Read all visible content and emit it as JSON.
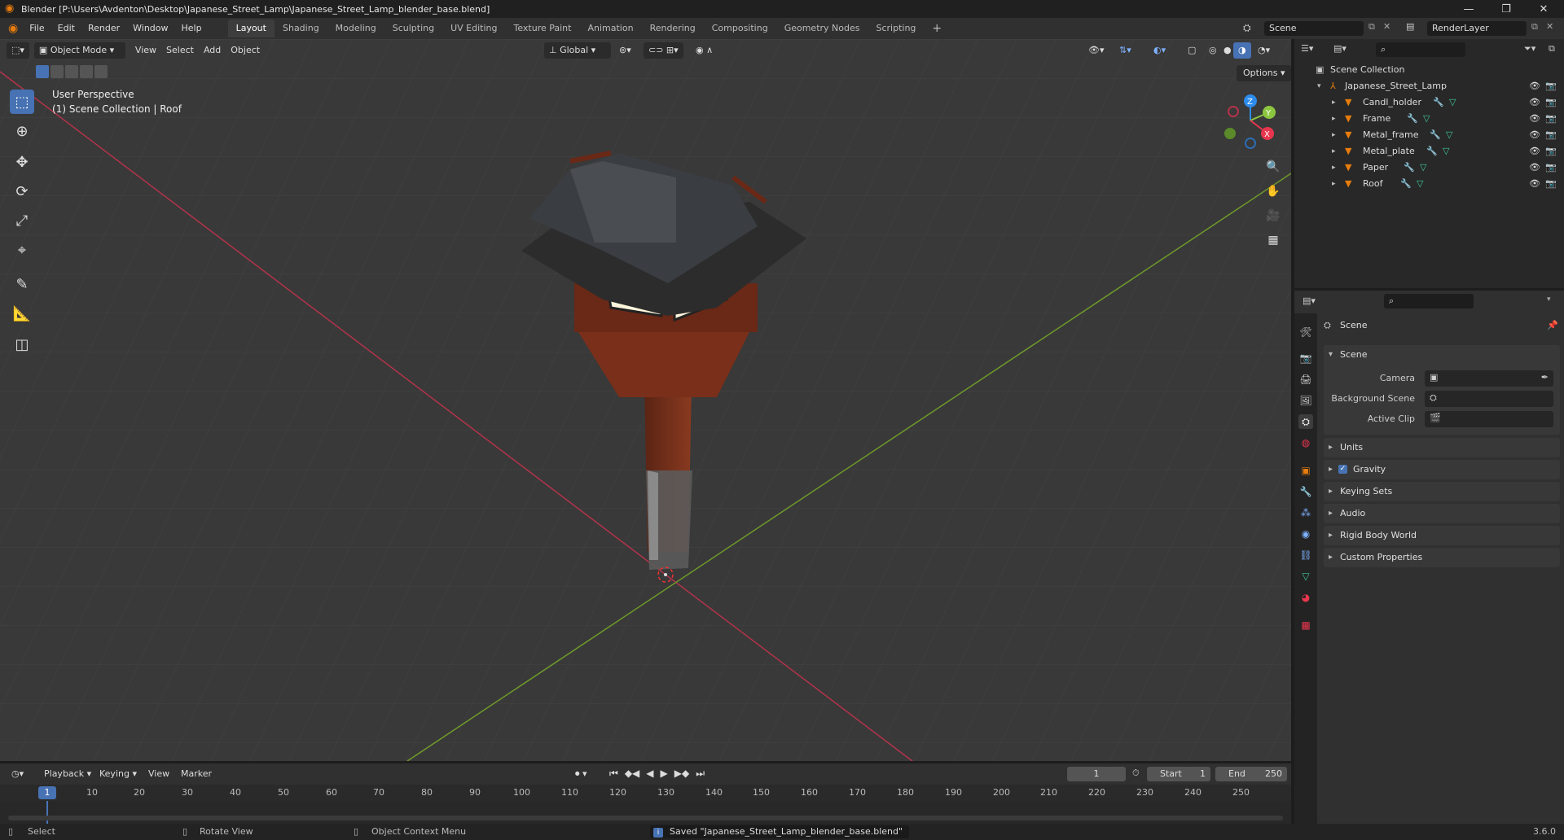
{
  "window": {
    "title": "Blender [P:\\Users\\Avdenton\\Desktop\\Japanese_Street_Lamp\\Japanese_Street_Lamp_blender_base.blend]"
  },
  "menu": {
    "file": "File",
    "edit": "Edit",
    "render": "Render",
    "window": "Window",
    "help": "Help"
  },
  "workspaces": [
    "Layout",
    "Shading",
    "Modeling",
    "Sculpting",
    "UV Editing",
    "Texture Paint",
    "Animation",
    "Rendering",
    "Compositing",
    "Geometry Nodes",
    "Scripting"
  ],
  "scene_selector": {
    "scene": "Scene",
    "view_layer": "RenderLayer"
  },
  "viewport": {
    "mode": "Object Mode",
    "menus": [
      "View",
      "Select",
      "Add",
      "Object"
    ],
    "orientation": "Global",
    "options": "Options",
    "overlay_title": "User Perspective",
    "overlay_subtitle": "(1) Scene Collection | Roof",
    "gizmo": {
      "z": "Z",
      "y": "Y",
      "x": "X"
    }
  },
  "outliner": {
    "root": "Scene Collection",
    "collection": "Japanese_Street_Lamp",
    "objects": [
      "Candl_holder",
      "Frame",
      "Metal_frame",
      "Metal_plate",
      "Paper",
      "Roof"
    ]
  },
  "properties": {
    "context": "Scene",
    "panel_scene": "Scene",
    "camera_label": "Camera",
    "background_scene_label": "Background Scene",
    "active_clip_label": "Active Clip",
    "panels": [
      "Units",
      "Gravity",
      "Keying Sets",
      "Audio",
      "Rigid Body World",
      "Custom Properties"
    ],
    "gravity_checked": true
  },
  "timeline": {
    "menus": [
      "Playback",
      "Keying",
      "View",
      "Marker"
    ],
    "current_frame": "1",
    "start_label": "Start",
    "start": "1",
    "end_label": "End",
    "end": "250",
    "ticks": [
      "1",
      "10",
      "20",
      "30",
      "40",
      "50",
      "60",
      "70",
      "80",
      "90",
      "100",
      "110",
      "120",
      "130",
      "140",
      "150",
      "160",
      "170",
      "180",
      "190",
      "200",
      "210",
      "220",
      "230",
      "240",
      "250"
    ]
  },
  "status": {
    "select": "Select",
    "rotate": "Rotate View",
    "context_menu": "Object Context Menu",
    "message": "Saved \"Japanese_Street_Lamp_blender_base.blend\"",
    "version": "3.6.0"
  },
  "colors": {
    "accent": "#4772b3",
    "x_axis": "#e8364e",
    "y_axis": "#8cc63f",
    "z_axis": "#2d8ceb",
    "brand": "#e87d0d"
  }
}
